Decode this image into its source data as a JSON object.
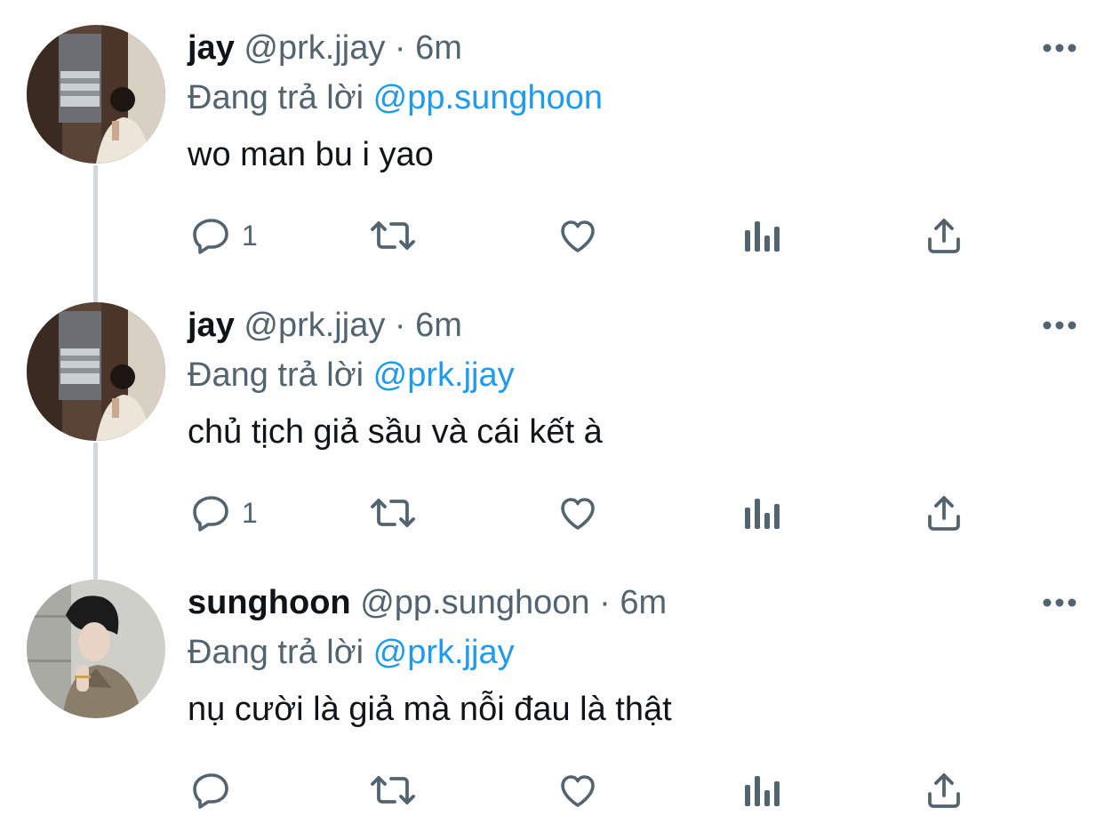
{
  "tweets": [
    {
      "name": "jay",
      "handle": "@prk.jjay",
      "dot": "·",
      "time": "6m",
      "reply_prefix": "Đang trả lời",
      "reply_to": "@pp.sunghoon",
      "text": "wo man bu i yao",
      "reply_count": "1",
      "avatar_icon": "avatar-jay-photo"
    },
    {
      "name": "jay",
      "handle": "@prk.jjay",
      "dot": "·",
      "time": "6m",
      "reply_prefix": "Đang trả lời",
      "reply_to": "@prk.jjay",
      "text": "chủ tịch giả sầu và cái kết à",
      "reply_count": "1",
      "avatar_icon": "avatar-jay-photo"
    },
    {
      "name": "sunghoon",
      "handle": "@pp.sunghoon",
      "dot": "·",
      "time": "6m",
      "reply_prefix": "Đang trả lời",
      "reply_to": "@prk.jjay",
      "text": "nụ cười là giả mà nỗi đau là thật",
      "reply_count": "",
      "avatar_icon": "avatar-sunghoon-photo"
    }
  ],
  "icons": {
    "reply": "reply-icon",
    "retweet": "retweet-icon",
    "like": "like-icon",
    "views": "views-icon",
    "share": "share-icon",
    "more": "more-icon"
  },
  "colors": {
    "text": "#0f1419",
    "secondary": "#536471",
    "accent": "#1d9bf0",
    "thread_line": "#cfd9de"
  }
}
